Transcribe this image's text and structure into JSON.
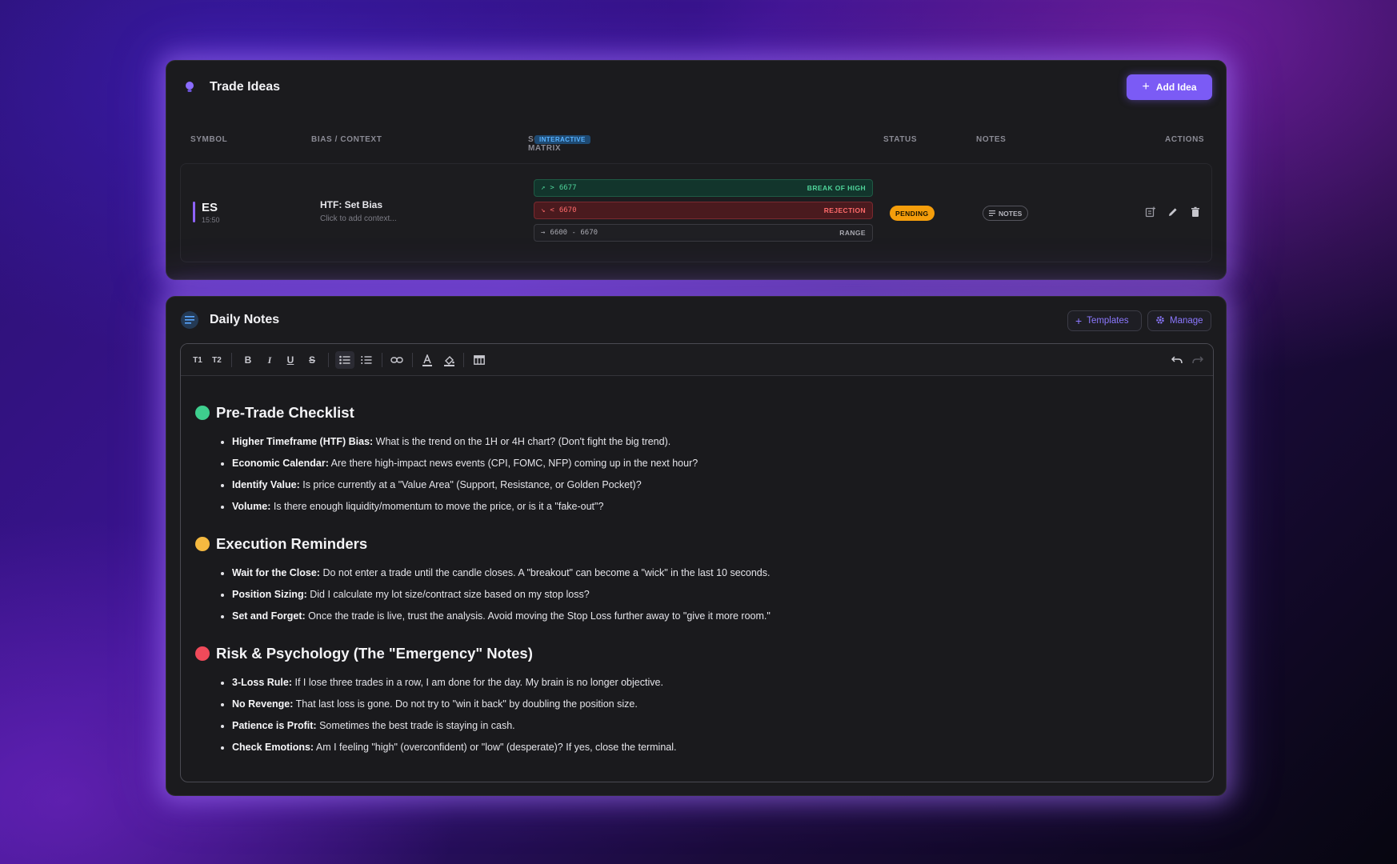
{
  "trade_ideas": {
    "title": "Trade Ideas",
    "add_button": "Add Idea",
    "columns": {
      "symbol": "SYMBOL",
      "bias": "BIAS / CONTEXT",
      "scenario": "SCENARIO MATRIX",
      "scenario_badge": "INTERACTIVE",
      "status": "STATUS",
      "notes": "NOTES",
      "actions": "ACTIONS"
    },
    "row": {
      "symbol": "ES",
      "time": "15:50",
      "bias_title": "HTF: Set Bias",
      "bias_placeholder": "Click to add context...",
      "scenarios": [
        {
          "icon": "↗",
          "prefix": ">",
          "value": "6677",
          "label": "BREAK OF HIGH",
          "color": "#4fd49a"
        },
        {
          "icon": "↘",
          "prefix": "<",
          "value": "6670",
          "label": "REJECTION",
          "color": "#ff6b6b"
        },
        {
          "icon": "→",
          "prefix": "",
          "value": "6600 - 6670",
          "label": "RANGE",
          "color": "#a8a8b0"
        }
      ],
      "status": "PENDING",
      "notes_label": "NOTES"
    }
  },
  "daily_notes": {
    "title": "Daily Notes",
    "templates_button": "Templates",
    "manage_button": "Manage",
    "toolbar": {
      "t1": "T1",
      "t2": "T2",
      "bold": "B",
      "italic": "I",
      "underline": "U",
      "strike": "S"
    },
    "sections": [
      {
        "heading": "Pre-Trade Checklist",
        "dot_color": "#3ecf8e",
        "items": [
          {
            "bold": "Higher Timeframe (HTF) Bias:",
            "text": " What is the trend on the 1H or 4H chart? (Don't fight the big trend)."
          },
          {
            "bold": "Economic Calendar:",
            "text": " Are there high-impact news events (CPI, FOMC, NFP) coming up in the next hour?"
          },
          {
            "bold": "Identify Value:",
            "text": " Is price currently at a \"Value Area\" (Support, Resistance, or Golden Pocket)?"
          },
          {
            "bold": "Volume:",
            "text": " Is there enough liquidity/momentum to move the price, or is it a \"fake-out\"?"
          }
        ]
      },
      {
        "heading": "Execution Reminders",
        "dot_color": "#f5b940",
        "items": [
          {
            "bold": "Wait for the Close:",
            "text": " Do not enter a trade until the candle closes. A \"breakout\" can become a \"wick\" in the last 10 seconds."
          },
          {
            "bold": "Position Sizing:",
            "text": " Did I calculate my lot size/contract size based on my stop loss?"
          },
          {
            "bold": "Set and Forget:",
            "text": " Once the trade is live, trust the analysis. Avoid moving the Stop Loss further away to \"give it more room.\""
          }
        ]
      },
      {
        "heading": "Risk & Psychology (The \"Emergency\" Notes)",
        "dot_color": "#f04a5a",
        "items": [
          {
            "bold": "3-Loss Rule:",
            "text": " If I lose three trades in a row, I am done for the day. My brain is no longer objective."
          },
          {
            "bold": "No Revenge:",
            "text": " That last loss is gone. Do not try to \"win it back\" by doubling the position size."
          },
          {
            "bold": "Patience is Profit:",
            "text": " Sometimes the best trade is staying in cash."
          },
          {
            "bold": "Check Emotions:",
            "text": " Am I feeling \"high\" (overconfident) or \"low\" (desperate)? If yes, close the terminal."
          }
        ]
      }
    ]
  }
}
